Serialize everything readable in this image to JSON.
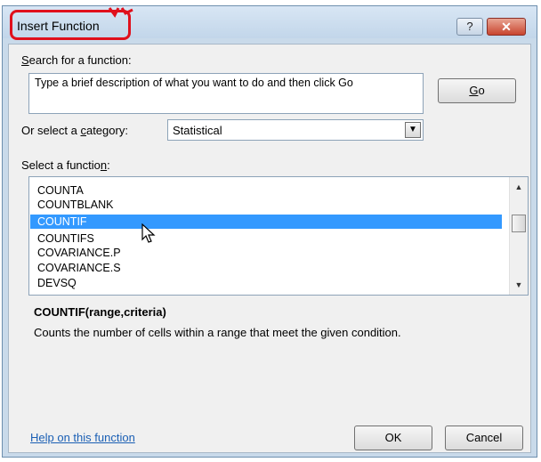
{
  "dialog": {
    "title": "Insert Function",
    "help_button": "?",
    "close_button": "✕"
  },
  "search": {
    "label_prefix": "",
    "label_accel": "S",
    "label_rest": "earch for a function:",
    "value": "Type a brief description of what you want to do and then click Go",
    "go_prefix": "",
    "go_accel": "G",
    "go_rest": "o"
  },
  "category": {
    "label_prefix": "Or select a ",
    "label_accel": "c",
    "label_rest": "ategory:",
    "selected": "Statistical"
  },
  "functions": {
    "label_prefix": "Select a functio",
    "label_accel": "n",
    "label_rest": ":",
    "items": [
      "COUNTA",
      "COUNTBLANK",
      "COUNTIF",
      "COUNTIFS",
      "COVARIANCE.P",
      "COVARIANCE.S",
      "DEVSQ"
    ],
    "selected_index": 2
  },
  "detail": {
    "signature": "COUNTIF(range,criteria)",
    "description": "Counts the number of cells within a range that meet the given condition."
  },
  "footer": {
    "help_link": "Help on this function",
    "ok": "OK",
    "cancel": "Cancel"
  },
  "colors": {
    "selection": "#3399ff",
    "annotation": "#e0101c",
    "link": "#1a5fb4"
  }
}
